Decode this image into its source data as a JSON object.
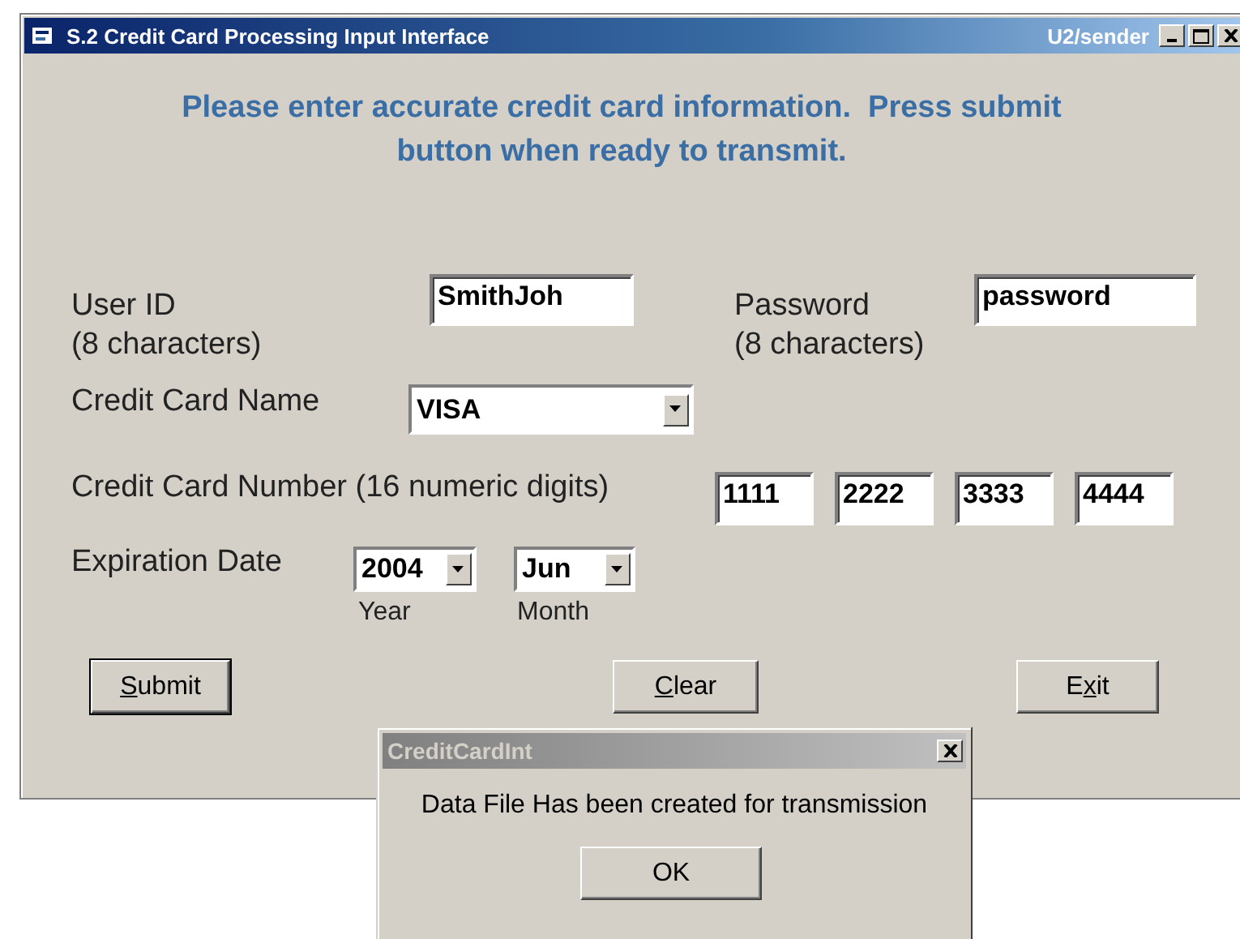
{
  "window": {
    "title": "S.2 Credit Card Processing Input Interface",
    "user": "U2/sender"
  },
  "instructions": [
    "Please enter accurate credit card information.  Press submit",
    "button when ready to transmit."
  ],
  "user_id": {
    "label": "User ID",
    "hint": "(8 characters)",
    "value": "SmithJoh"
  },
  "password": {
    "label": "Password",
    "hint": "(8 characters)",
    "value": "password"
  },
  "card_name": {
    "label": "Credit Card Name",
    "value": "VISA"
  },
  "card_number": {
    "label": "Credit Card Number (16 numeric digits)",
    "groups": [
      "1111",
      "2222",
      "3333",
      "4444"
    ]
  },
  "expiration": {
    "label": "Expiration Date",
    "year": {
      "value": "2004",
      "caption": "Year"
    },
    "month": {
      "value": "Jun",
      "caption": "Month"
    }
  },
  "buttons": [
    {
      "label": [
        {
          "text": "S",
          "underlined": true
        },
        {
          "text": "ubmit",
          "underlined": false
        }
      ],
      "focused": true
    },
    {
      "label": [
        {
          "text": "C",
          "underlined": true
        },
        {
          "text": "lear",
          "underlined": false
        }
      ],
      "focused": false
    },
    {
      "label": [
        {
          "text": "E",
          "underlined": false
        },
        {
          "text": "x",
          "underlined": true
        },
        {
          "text": "it",
          "underlined": false
        }
      ],
      "focused": false
    }
  ],
  "dialog": {
    "title": "CreditCardInt",
    "message": "Data File Has been created for transmission",
    "button": "OK"
  }
}
